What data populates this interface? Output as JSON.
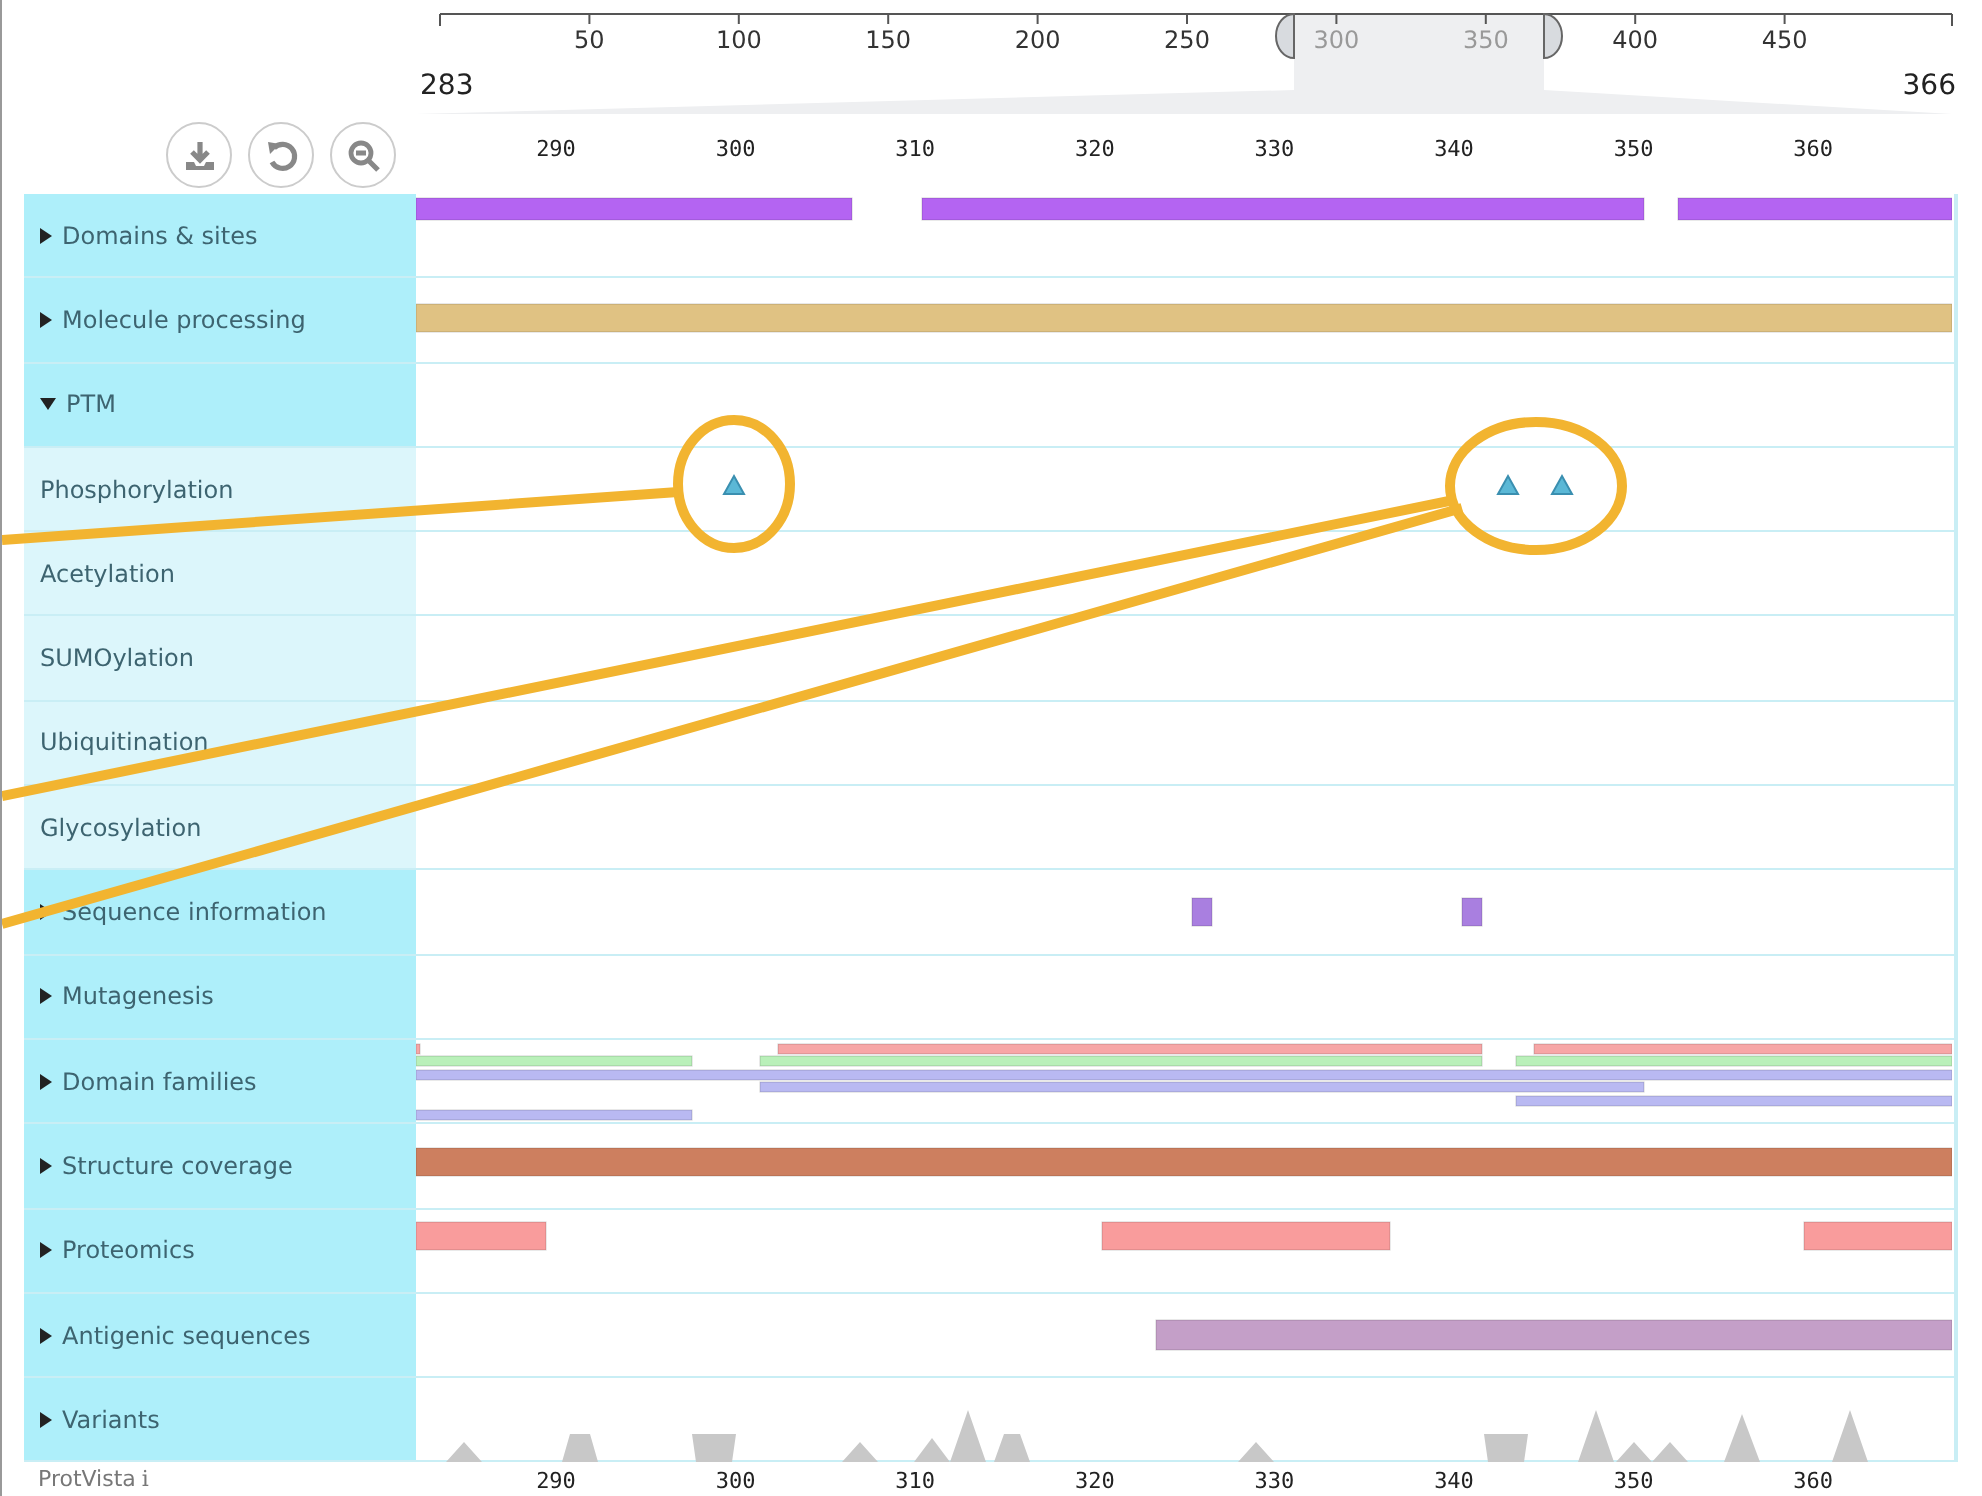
{
  "overview_ruler": {
    "ticks": [
      "50",
      "100",
      "150",
      "200",
      "250",
      "300",
      "350",
      "400",
      "450"
    ],
    "range_start": "283",
    "range_end": "366"
  },
  "detail_ruler": {
    "ticks": [
      "290",
      "300",
      "310",
      "320",
      "330",
      "340",
      "350",
      "360"
    ]
  },
  "tracks": [
    {
      "label": "Domains & sites",
      "expanded": false
    },
    {
      "label": "Molecule processing",
      "expanded": false
    },
    {
      "label": "PTM",
      "expanded": true,
      "children": [
        {
          "label": "Phosphorylation"
        },
        {
          "label": "Acetylation"
        },
        {
          "label": "SUMOylation"
        },
        {
          "label": "Ubiquitination"
        },
        {
          "label": "Glycosylation"
        }
      ]
    },
    {
      "label": "Sequence information",
      "expanded": false
    },
    {
      "label": "Mutagenesis",
      "expanded": false
    },
    {
      "label": "Domain families",
      "expanded": false
    },
    {
      "label": "Structure coverage",
      "expanded": false
    },
    {
      "label": "Proteomics",
      "expanded": false
    },
    {
      "label": "Antigenic sequences",
      "expanded": false
    },
    {
      "label": "Variants",
      "expanded": false
    }
  ],
  "footer": {
    "brand": "ProtVista",
    "info": "i"
  },
  "bottom_ruler": {
    "ticks": [
      "290",
      "300",
      "310",
      "320",
      "330",
      "340",
      "350",
      "360"
    ]
  }
}
